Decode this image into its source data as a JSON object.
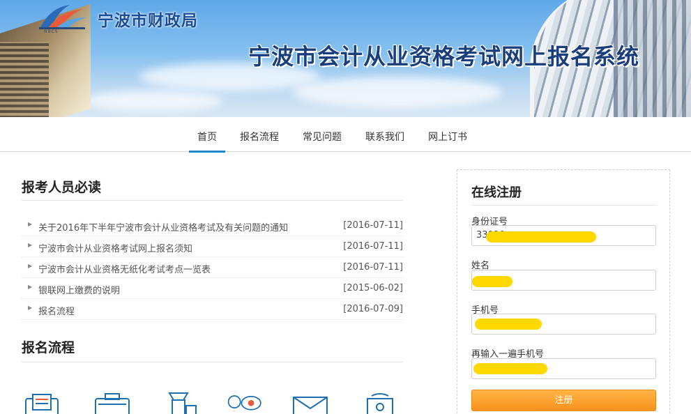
{
  "banner": {
    "org_name": "宁波市财政局",
    "logo_sub": "NBCS",
    "system_title": "宁波市会计从业资格考试网上报名系统"
  },
  "nav": {
    "items": [
      {
        "label": "首页",
        "active": true
      },
      {
        "label": "报名流程",
        "active": false
      },
      {
        "label": "常见问题",
        "active": false
      },
      {
        "label": "联系我们",
        "active": false
      },
      {
        "label": "网上订书",
        "active": false
      }
    ]
  },
  "notices": {
    "title": "报考人员必读",
    "items": [
      {
        "title": "关于2016年下半年宁波市会计从业资格考试及有关问题的通知",
        "date": "[2016-07-11]"
      },
      {
        "title": "宁波市会计从业资格考试网上报名须知",
        "date": "[2016-07-11]"
      },
      {
        "title": "宁波市会计从业资格无纸化考试考点一览表",
        "date": "[2016-07-11]"
      },
      {
        "title": "银联网上缴费的说明",
        "date": "[2015-06-02]"
      },
      {
        "title": "报名流程",
        "date": "[2016-07-09]"
      }
    ]
  },
  "process": {
    "title": "报名流程",
    "icons": [
      "registration-form-icon",
      "camera-photo-icon",
      "payment-machine-icon",
      "review-eye-icon",
      "print-ticket-icon",
      "exam-icon"
    ]
  },
  "register": {
    "title": "在线注册",
    "id_label": "身份证号",
    "id_value": "33020",
    "name_label": "姓名",
    "name_value": "",
    "phone_label": "手机号",
    "phone_value": "",
    "phone_confirm_label": "再输入一遍手机号",
    "phone_confirm_value": "13",
    "submit_label": "注册"
  },
  "colors": {
    "nav_active": "#1f86c7",
    "button": "#f7931e",
    "redaction": "#ffd800",
    "title_blue": "#1a3d7c"
  }
}
